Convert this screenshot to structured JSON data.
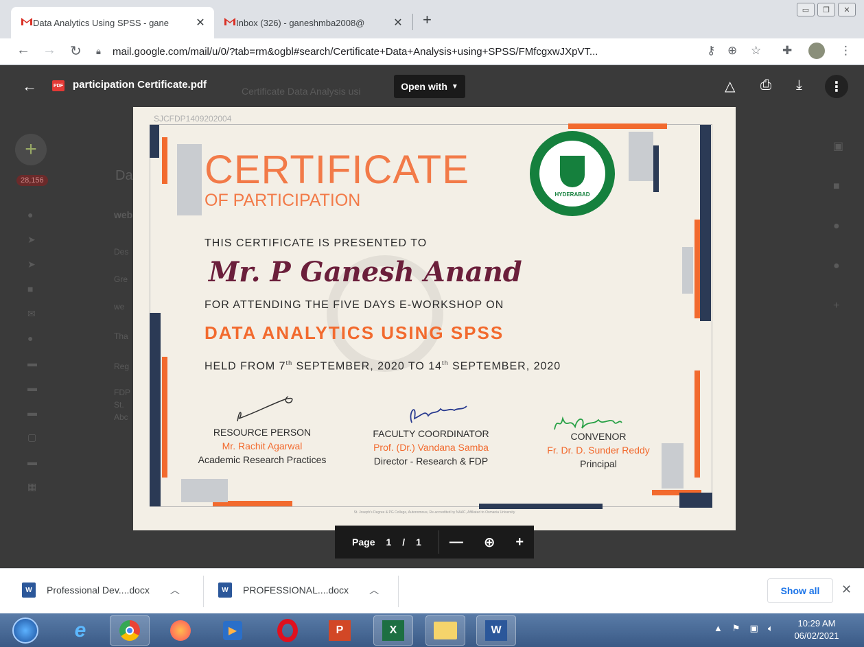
{
  "browser": {
    "tabs": [
      {
        "title": "Data Analytics Using SPSS - gane",
        "active": true
      },
      {
        "title": "Inbox (326) - ganeshmba2008@",
        "active": false
      }
    ],
    "new_tab": "+",
    "url": "mail.google.com/mail/u/0/?tab=rm&ogbl#search/Certificate+Data+Analysis+using+SPSS/FMfcgxwJXpVT...",
    "window_controls": [
      "minimize",
      "restore",
      "close"
    ]
  },
  "gmail_bg": {
    "unread_badge": "28,156",
    "search_text": "Certificate Data Analysis usi",
    "subject_start": "Da",
    "sender_start": "web",
    "lines": [
      "Des",
      "Gre",
      "we",
      "Tha",
      "Reg",
      "FDP",
      "St.",
      "Abc"
    ]
  },
  "viewer": {
    "file_name": "participation Certificate.pdf",
    "pdf_badge": "PDF",
    "open_with": "Open with",
    "page_label": "Page",
    "page_current": "1",
    "page_sep": "/",
    "page_total": "1"
  },
  "certificate": {
    "id": "SJCFDP1409202004",
    "title": "CERTIFICATE",
    "subtitle": "OF PARTICIPATION",
    "presented": "THIS CERTIFICATE IS PRESENTED TO",
    "recipient": "Mr. P Ganesh Anand",
    "attending": "FOR ATTENDING THE FIVE DAYS E-WORKSHOP ON",
    "course": "DATA ANALYTICS USING SPSS",
    "held_prefix": "HELD  FROM 7",
    "held_sup1": "th",
    "held_mid": " SEPTEMBER, 2020 TO 14",
    "held_sup2": "th",
    "held_suffix": " SEPTEMBER, 2020",
    "seal_text": "HYDERABAD",
    "signatories": [
      {
        "role": "RESOURCE PERSON",
        "name": "Mr. Rachit Agarwal",
        "designation": "Academic Research Practices"
      },
      {
        "role": "FACULTY COORDINATOR",
        "name": "Prof. (Dr.) Vandana Samba",
        "designation": "Director - Research & FDP"
      },
      {
        "role": "CONVENOR",
        "name": "Fr. Dr. D. Sunder Reddy",
        "designation": "Principal"
      }
    ],
    "footer": "St. Joseph's Degree & PG College, Autonomous, Re-accredited by NAAC, Affiliated to Osmania University"
  },
  "downloads": [
    {
      "name": "Professional Dev....docx"
    },
    {
      "name": "PROFESSIONAL....docx"
    }
  ],
  "show_all": "Show all",
  "taskbar": {
    "time": "10:29 AM",
    "date": "06/02/2021"
  }
}
